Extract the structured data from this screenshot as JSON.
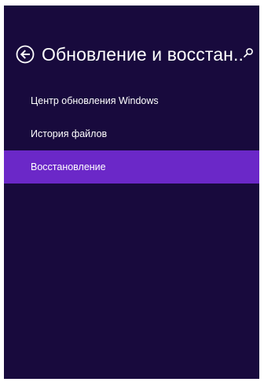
{
  "header": {
    "title": "Обновление и восстан..",
    "back_icon": "back-arrow-icon",
    "search_icon": "search-icon"
  },
  "nav": {
    "items": [
      {
        "label": "Центр обновления Windows",
        "selected": false
      },
      {
        "label": "История файлов",
        "selected": false
      },
      {
        "label": "Восстановление",
        "selected": true
      }
    ]
  },
  "colors": {
    "background": "#180a3d",
    "accent": "#6b28c8",
    "text": "#ffffff"
  }
}
